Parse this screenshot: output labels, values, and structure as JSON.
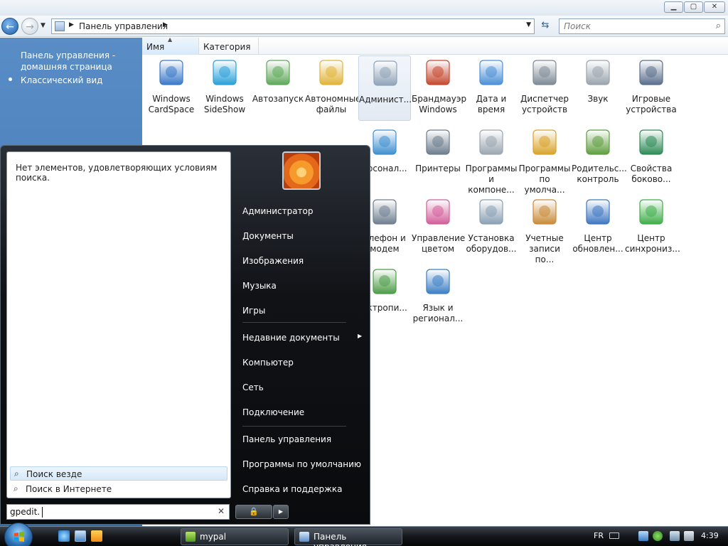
{
  "window": {
    "address_path": "Панель управления",
    "search_placeholder": "Поиск"
  },
  "sidebar": {
    "home_link": "Панель управления - домашняя страница",
    "classic_view": "Классический вид"
  },
  "columns": {
    "name": "Имя",
    "category": "Категория"
  },
  "control_panel_items": [
    {
      "label": "Windows\nCardSpace",
      "icon": "cardspace-icon"
    },
    {
      "label": "Windows\nSideShow",
      "icon": "sideshow-icon"
    },
    {
      "label": "Автозапуск",
      "icon": "autoplay-icon"
    },
    {
      "label": "Автономные\nфайлы",
      "icon": "offline-files-icon"
    },
    {
      "label": "Админист...",
      "icon": "admin-tools-icon"
    },
    {
      "label": "Брандмауэр\nWindows",
      "icon": "firewall-icon"
    },
    {
      "label": "Дата и\nвремя",
      "icon": "date-time-icon"
    },
    {
      "label": "Диспетчер\nустройств",
      "icon": "device-manager-icon"
    },
    {
      "label": "Звук",
      "icon": "sound-icon"
    },
    {
      "label": "Игровые\nустройства",
      "icon": "game-controllers-icon"
    },
    {
      "label": "ерсонал...",
      "icon": "personalization-icon"
    },
    {
      "label": "Принтеры",
      "icon": "printers-icon"
    },
    {
      "label": "Программы\nи компоне...",
      "icon": "programs-features-icon"
    },
    {
      "label": "Программы\nпо умолча...",
      "icon": "default-programs-icon"
    },
    {
      "label": "Родительс...\nконтроль",
      "icon": "parental-controls-icon"
    },
    {
      "label": "Свойства\nбоково...",
      "icon": "sidebar-properties-icon"
    },
    {
      "label": "елефон и\nмодем",
      "icon": "phone-modem-icon"
    },
    {
      "label": "Управление\nцветом",
      "icon": "color-management-icon"
    },
    {
      "label": "Установка\nоборудов...",
      "icon": "add-hardware-icon"
    },
    {
      "label": "Учетные\nзаписи по...",
      "icon": "user-accounts-icon"
    },
    {
      "label": "Центр\nобновлен...",
      "icon": "windows-update-icon"
    },
    {
      "label": "Центр\nсинхрониз...",
      "icon": "sync-center-icon"
    },
    {
      "label": "ектропи...",
      "icon": "power-options-icon"
    },
    {
      "label": "Язык и\nрегионал...",
      "icon": "regional-language-icon"
    }
  ],
  "start_menu": {
    "no_results": "Нет элементов, удовлетворяющих условиям поиска.",
    "search_everywhere": "Поиск везде",
    "search_internet": "Поиск в Интернете",
    "search_query": "gpedit.",
    "right_items": [
      "Администратор",
      "Документы",
      "Изображения",
      "Музыка",
      "Игры",
      "Недавние документы",
      "Компьютер",
      "Сеть",
      "Подключение",
      "Панель управления",
      "Программы по умолчанию",
      "Справка и поддержка"
    ]
  },
  "taskbar": {
    "buttons": [
      "mypal",
      "Панель управления"
    ],
    "language": "FR",
    "clock": "4:39"
  },
  "colors": {
    "sidebar_top": "#5a8dc6",
    "sidebar_bottom": "#2f6aa9",
    "start_menu_bg": "#0a0b0d",
    "taskbar_bg": "#14171b"
  }
}
